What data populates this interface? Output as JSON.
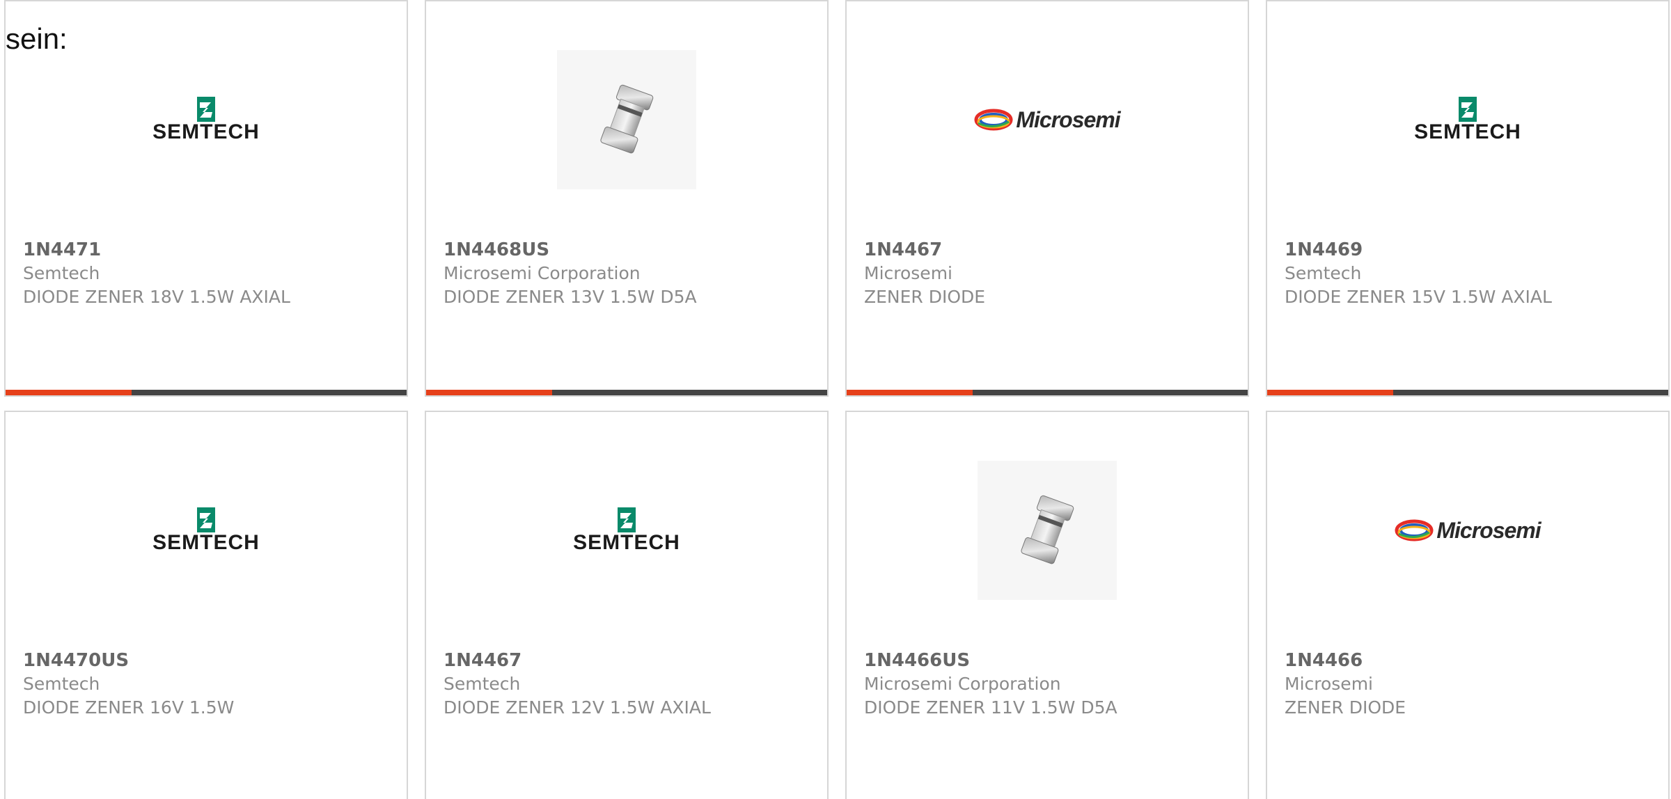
{
  "intro": {
    "text": "sein:"
  },
  "colors": {
    "accent": "#e6401a",
    "bar_base": "#444444",
    "card_border": "#d6d6d6",
    "semtech_green": "#0a8a6a"
  },
  "cards": [
    {
      "image": "semtech-logo",
      "logo_text": "SEMTECH",
      "part_number": "1N4471",
      "manufacturer": "Semtech",
      "description": "DIODE ZENER 18V 1.5W AXIAL"
    },
    {
      "image": "diode-photo",
      "part_number": "1N4468US",
      "manufacturer": "Microsemi Corporation",
      "description": "DIODE ZENER 13V 1.5W D5A"
    },
    {
      "image": "microsemi-logo",
      "logo_text": "Microsemi",
      "part_number": "1N4467",
      "manufacturer": "Microsemi",
      "description": "ZENER DIODE"
    },
    {
      "image": "semtech-logo",
      "logo_text": "SEMTECH",
      "part_number": "1N4469",
      "manufacturer": "Semtech",
      "description": "DIODE ZENER 15V 1.5W AXIAL"
    },
    {
      "image": "semtech-logo",
      "logo_text": "SEMTECH",
      "part_number": "1N4470US",
      "manufacturer": "Semtech",
      "description": "DIODE ZENER 16V 1.5W"
    },
    {
      "image": "semtech-logo",
      "logo_text": "SEMTECH",
      "part_number": "1N4467",
      "manufacturer": "Semtech",
      "description": "DIODE ZENER 12V 1.5W AXIAL"
    },
    {
      "image": "diode-photo",
      "part_number": "1N4466US",
      "manufacturer": "Microsemi Corporation",
      "description": "DIODE ZENER 11V 1.5W D5A"
    },
    {
      "image": "microsemi-logo",
      "logo_text": "Microsemi",
      "part_number": "1N4466",
      "manufacturer": "Microsemi",
      "description": "ZENER DIODE"
    }
  ]
}
